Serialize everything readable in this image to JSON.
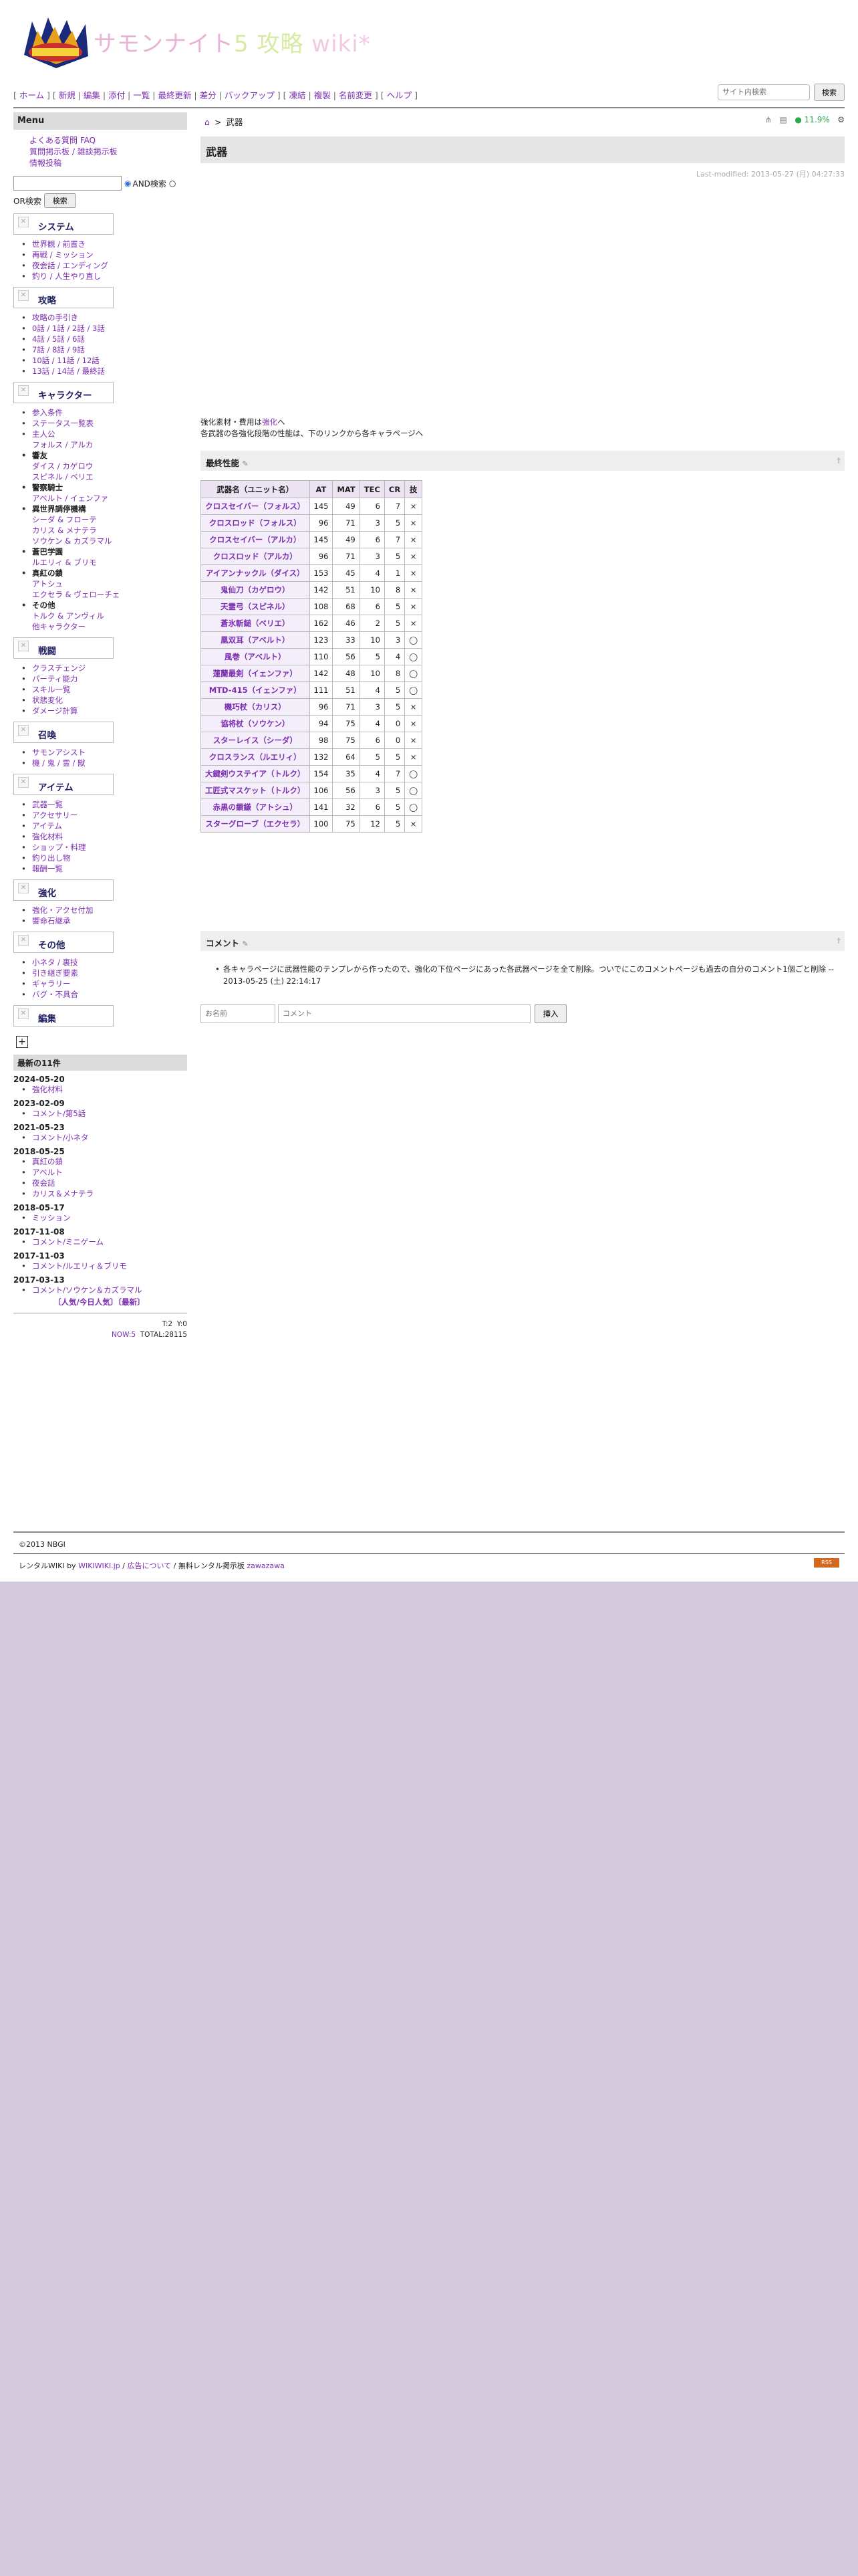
{
  "header": {
    "title_1": "サモンナイト",
    "title_2": "5",
    "title_3": " 攻略 ",
    "title_4": "wiki*"
  },
  "nav": {
    "items": [
      "ホーム",
      "新規",
      "編集",
      "添付",
      "一覧",
      "最終更新",
      "差分",
      "バックアップ",
      "凍結",
      "複製",
      "名前変更",
      "ヘルプ"
    ]
  },
  "sitesearch": {
    "placeholder": "サイト内検索",
    "button": "検索"
  },
  "menu": {
    "title": "Menu",
    "links": [
      "よくある質問 FAQ",
      "質問掲示板 / 雑談掲示板",
      "情報投稿"
    ],
    "and_label": "AND検索",
    "or_label": "OR検索",
    "search_button": "検索",
    "sections": [
      {
        "label": "システム",
        "items": [
          {
            "t": "世界観 / 前置き",
            "dot": true
          },
          {
            "t": "再戦 / ミッション",
            "dot": true
          },
          {
            "t": "夜会話 / エンディング",
            "dot": true
          },
          {
            "t": "釣り / 人生やり直し",
            "dot": true
          }
        ]
      },
      {
        "label": "攻略",
        "items": [
          {
            "t": "攻略の手引き",
            "dot": true
          },
          {
            "t": "0話 / 1話 / 2話 / 3話",
            "dot": true
          },
          {
            "t": "4話 / 5話 / 6話",
            "dot": true
          },
          {
            "t": "7話 / 8話 / 9話",
            "dot": true
          },
          {
            "t": "10話 / 11話 / 12話",
            "dot": true
          },
          {
            "t": "13話 / 14話 / 最終話",
            "dot": true
          }
        ]
      },
      {
        "label": "キャラクター",
        "items": [
          {
            "t": "参入条件",
            "dot": true
          },
          {
            "t": "ステータス一覧表",
            "dot": true
          },
          {
            "t": "主人公",
            "dot": true
          },
          {
            "t": "フォルス / アルカ",
            "dot": false
          },
          {
            "t": "響友",
            "dot": true,
            "bold": true
          },
          {
            "t": "ダイス / カゲロウ",
            "dot": false
          },
          {
            "t": "スピネル / ベリエ",
            "dot": false
          },
          {
            "t": "警察騎士",
            "dot": true,
            "bold": true
          },
          {
            "t": "アベルト / イェンファ",
            "dot": false
          },
          {
            "t": "異世界調停機構",
            "dot": true,
            "bold": true
          },
          {
            "t": "シーダ & フローテ",
            "dot": false
          },
          {
            "t": "カリス & メナテラ",
            "dot": false
          },
          {
            "t": "ソウケン & カズラマル",
            "dot": false
          },
          {
            "t": "蒼巴学園",
            "dot": true,
            "bold": true
          },
          {
            "t": "ルエリィ & ブリモ",
            "dot": false
          },
          {
            "t": "真紅の鎖",
            "dot": true,
            "bold": true
          },
          {
            "t": "アトシュ",
            "dot": false
          },
          {
            "t": "エクセラ & ヴェローチェ",
            "dot": false
          },
          {
            "t": "その他",
            "dot": true,
            "bold": true
          },
          {
            "t": "トルク & アンヴィル",
            "dot": false
          },
          {
            "t": "他キャラクター",
            "dot": false
          }
        ]
      },
      {
        "label": "戦闘",
        "items": [
          {
            "t": "クラスチェンジ",
            "dot": true
          },
          {
            "t": "パーティ能力",
            "dot": true
          },
          {
            "t": "スキル一覧",
            "dot": true
          },
          {
            "t": "状態変化",
            "dot": true
          },
          {
            "t": "ダメージ計算",
            "dot": true
          }
        ]
      },
      {
        "label": "召喚",
        "items": [
          {
            "t": "サモンアシスト",
            "dot": true
          },
          {
            "t": "機 / 鬼 / 霊 / 獣",
            "dot": true
          }
        ]
      },
      {
        "label": "アイテム",
        "items": [
          {
            "t": "武器一覧",
            "dot": true
          },
          {
            "t": "アクセサリー",
            "dot": true
          },
          {
            "t": "アイテム",
            "dot": true
          },
          {
            "t": "強化材料",
            "dot": true
          },
          {
            "t": "ショップ・料理",
            "dot": true
          },
          {
            "t": "釣り出し物",
            "dot": true
          },
          {
            "t": "報酬一覧",
            "dot": true
          }
        ]
      },
      {
        "label": "強化",
        "items": [
          {
            "t": "強化・アクセ付加",
            "dot": true
          },
          {
            "t": "響命石継承",
            "dot": true
          }
        ]
      },
      {
        "label": "その他",
        "items": [
          {
            "t": "小ネタ / 裏技",
            "dot": true
          },
          {
            "t": "引き継ぎ要素",
            "dot": true
          },
          {
            "t": "ギャラリー",
            "dot": true
          },
          {
            "t": "バグ・不具合",
            "dot": true
          }
        ]
      },
      {
        "label": "編集",
        "items": []
      }
    ],
    "recent_title": "最新の11件",
    "recent": [
      {
        "date": "2024-05-20",
        "items": [
          "強化材料"
        ]
      },
      {
        "date": "2023-02-09",
        "items": [
          "コメント/第5話"
        ]
      },
      {
        "date": "2021-05-23",
        "items": [
          "コメント/小ネタ"
        ]
      },
      {
        "date": "2018-05-25",
        "items": [
          "真紅の鎖",
          "アベルト",
          "夜会話",
          "カリス＆メナテラ"
        ]
      },
      {
        "date": "2018-05-17",
        "items": [
          "ミッション"
        ]
      },
      {
        "date": "2017-11-08",
        "items": [
          "コメント/ミニゲーム"
        ]
      },
      {
        "date": "2017-11-03",
        "items": [
          "コメント/ルエリィ＆ブリモ"
        ]
      },
      {
        "date": "2017-03-13",
        "items": [
          "コメント/ソウケン＆カズラマル"
        ]
      }
    ],
    "popular": "〔人気/今日人気〕〔最新〕",
    "counter_today": "T:2",
    "counter_yesterday": "Y:0",
    "now_label": "NOW:5",
    "total_label": "TOTAL:28115"
  },
  "main": {
    "breadcrumb_sep": ">",
    "breadcrumb": "武器",
    "view_count": "11.9%",
    "page_title": "武器",
    "last_modified": "Last-modified: 2013-05-27 (月) 04:27:33",
    "intro_1_a": "強化素材・費用は",
    "intro_1_link": "強化",
    "intro_1_b": "へ",
    "intro_2": "各武器の各強化段階の性能は、下のリンクから各キャラページへ",
    "section_final": "最終性能",
    "section_comment": "コメント",
    "table_headers": [
      "武器名（ユニット名）",
      "AT",
      "MAT",
      "TEC",
      "CR",
      "技"
    ],
    "table_rows": [
      [
        "クロスセイバー（フォルス）",
        "145",
        "49",
        "6",
        "7",
        "×"
      ],
      [
        "クロスロッド（フォルス）",
        "96",
        "71",
        "3",
        "5",
        "×"
      ],
      [
        "クロスセイバー（アルカ）",
        "145",
        "49",
        "6",
        "7",
        "×"
      ],
      [
        "クロスロッド（アルカ）",
        "96",
        "71",
        "3",
        "5",
        "×"
      ],
      [
        "アイアンナックル（ダイス）",
        "153",
        "45",
        "4",
        "1",
        "×"
      ],
      [
        "鬼仙刀（カゲロウ）",
        "142",
        "51",
        "10",
        "8",
        "×"
      ],
      [
        "天霊弓（スピネル）",
        "108",
        "68",
        "6",
        "5",
        "×"
      ],
      [
        "蒼氷斬鎚（ベリエ）",
        "162",
        "46",
        "2",
        "5",
        "×"
      ],
      [
        "凰双耳（アベルト）",
        "123",
        "33",
        "10",
        "3",
        "◯"
      ],
      [
        "風巻（アベルト）",
        "110",
        "56",
        "5",
        "4",
        "◯"
      ],
      [
        "蓮蘭最剣（イェンファ）",
        "142",
        "48",
        "10",
        "8",
        "◯"
      ],
      [
        "MTD-415（イェンファ）",
        "111",
        "51",
        "4",
        "5",
        "◯"
      ],
      [
        "機巧杖（カリス）",
        "96",
        "71",
        "3",
        "5",
        "×"
      ],
      [
        "協将杖（ソウケン）",
        "94",
        "75",
        "4",
        "0",
        "×"
      ],
      [
        "スターレイス（シーダ）",
        "98",
        "75",
        "6",
        "0",
        "×"
      ],
      [
        "クロスランス（ルエリィ）",
        "132",
        "64",
        "5",
        "5",
        "×"
      ],
      [
        "大鍵剣ウステイア（トルク）",
        "154",
        "35",
        "4",
        "7",
        "◯"
      ],
      [
        "工匠式マスケット（トルク）",
        "106",
        "56",
        "3",
        "5",
        "◯"
      ],
      [
        "赤黒の鎖鎌（アトシュ）",
        "141",
        "32",
        "6",
        "5",
        "◯"
      ],
      [
        "スターグローブ（エクセラ）",
        "100",
        "75",
        "12",
        "5",
        "×"
      ]
    ],
    "comment_text": "各キャラページに武器性能のテンプレから作ったので、強化の下位ページにあった各武器ページを全て削除。ついでにこのコメントページも過去の自分のコメント1個ごと削除 -- 2013-05-25 (土) 22:14:17",
    "name_placeholder": "お名前",
    "comment_placeholder": "コメント",
    "submit_label": "挿入"
  },
  "footer": {
    "copyright": "©2013 NBGI",
    "rent_a": "レンタルWIKI by ",
    "rent_link1": "WIKIWIKI.jp",
    "rent_sep": " / ",
    "rent_link2": "広告について",
    "rent_b": " / 無料レンタル掲示板 ",
    "rent_link3": "zawazawa"
  }
}
